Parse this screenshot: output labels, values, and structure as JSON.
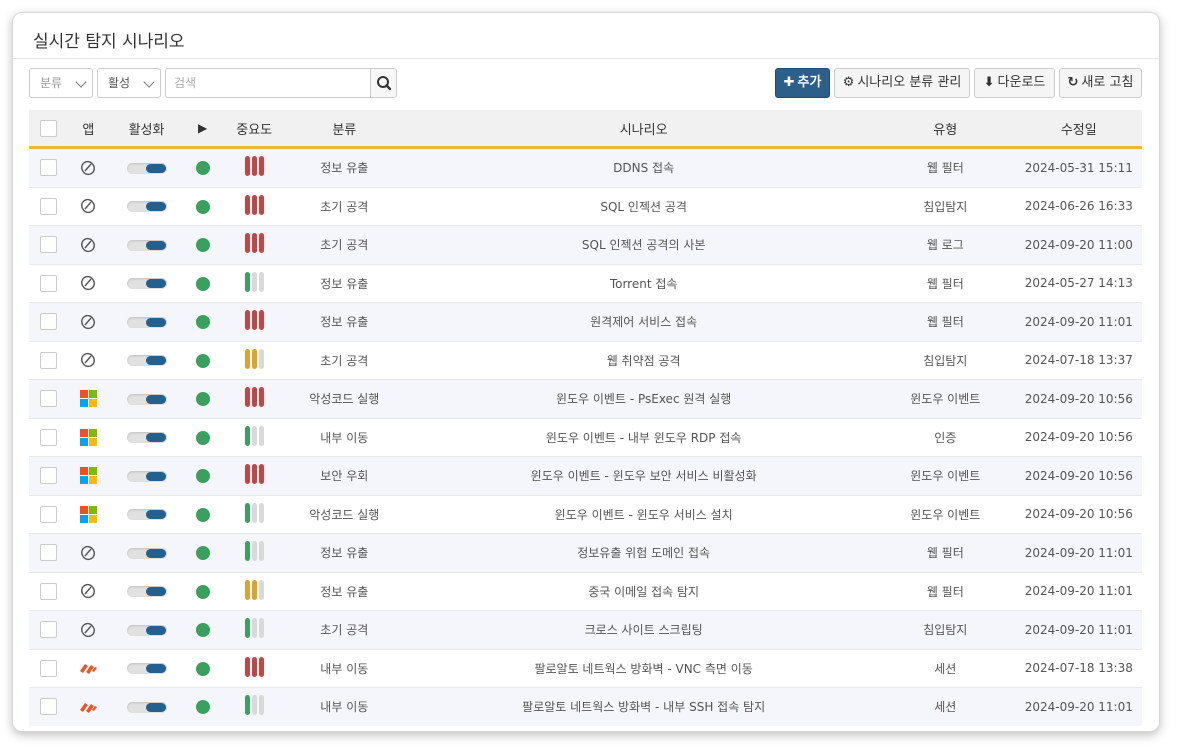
{
  "title": "실시간 탐지 시나리오",
  "toolbar": {
    "category_filter": "분류",
    "active_filter": "활성",
    "search_placeholder": "검색",
    "add_label": "추가",
    "category_manage_label": "시나리오 분류 관리",
    "download_label": "다운로드",
    "refresh_label": "새로 고침"
  },
  "colors": {
    "accent": "#2c5f8a",
    "header_underline": "#f0b92d",
    "severity_high": "#c54545",
    "severity_medium": "#e0a22a",
    "severity_low": "#3aa05d",
    "status_active": "#3aa05d"
  },
  "columns": [
    "앱",
    "활성화",
    "",
    "중요도",
    "분류",
    "시나리오",
    "유형",
    "수정일"
  ],
  "rows": [
    {
      "app": "link-icon",
      "active": true,
      "severity": "high",
      "category": "정보 유출",
      "scenario": "DDNS 접속",
      "type": "웹 필터",
      "modified": "2024-05-31 15:11"
    },
    {
      "app": "link-icon",
      "active": true,
      "severity": "high",
      "category": "초기 공격",
      "scenario": "SQL 인젝션 공격",
      "type": "침입탐지",
      "modified": "2024-06-26 16:33"
    },
    {
      "app": "link-icon",
      "active": true,
      "severity": "high",
      "category": "초기 공격",
      "scenario": "SQL 인젝션 공격의 사본",
      "type": "웹 로그",
      "modified": "2024-09-20 11:00"
    },
    {
      "app": "link-icon",
      "active": true,
      "severity": "low",
      "category": "정보 유출",
      "scenario": "Torrent 접속",
      "type": "웹 필터",
      "modified": "2024-05-27 14:13"
    },
    {
      "app": "link-icon",
      "active": true,
      "severity": "high",
      "category": "정보 유출",
      "scenario": "원격제어 서비스 접속",
      "type": "웹 필터",
      "modified": "2024-09-20 11:01"
    },
    {
      "app": "link-icon",
      "active": true,
      "severity": "medium",
      "category": "초기 공격",
      "scenario": "웹 취약점 공격",
      "type": "침입탐지",
      "modified": "2024-07-18 13:37"
    },
    {
      "app": "windows-icon",
      "active": true,
      "severity": "high",
      "category": "악성코드 실행",
      "scenario": "윈도우 이벤트 - PsExec 원격 실행",
      "type": "윈도우 이벤트",
      "modified": "2024-09-20 10:56"
    },
    {
      "app": "windows-icon",
      "active": true,
      "severity": "low",
      "category": "내부 이동",
      "scenario": "윈도우 이벤트 - 내부 윈도우 RDP 접속",
      "type": "인증",
      "modified": "2024-09-20 10:56"
    },
    {
      "app": "windows-icon",
      "active": true,
      "severity": "high",
      "category": "보안 우회",
      "scenario": "윈도우 이벤트 - 윈도우 보안 서비스 비활성화",
      "type": "윈도우 이벤트",
      "modified": "2024-09-20 10:56"
    },
    {
      "app": "windows-icon",
      "active": true,
      "severity": "low",
      "category": "악성코드 실행",
      "scenario": "윈도우 이벤트 - 윈도우 서비스 설치",
      "type": "윈도우 이벤트",
      "modified": "2024-09-20 10:56"
    },
    {
      "app": "link-icon",
      "active": true,
      "severity": "low",
      "category": "정보 유출",
      "scenario": "정보유출 위험 도메인 접속",
      "type": "웹 필터",
      "modified": "2024-09-20 11:01"
    },
    {
      "app": "link-icon",
      "active": true,
      "severity": "medium",
      "category": "정보 유출",
      "scenario": "중국 이메일 접속 탐지",
      "type": "웹 필터",
      "modified": "2024-09-20 11:01"
    },
    {
      "app": "link-icon",
      "active": true,
      "severity": "low",
      "category": "초기 공격",
      "scenario": "크로스 사이트 스크립팅",
      "type": "침입탐지",
      "modified": "2024-09-20 11:01"
    },
    {
      "app": "paloalto-icon",
      "active": true,
      "severity": "high",
      "category": "내부 이동",
      "scenario": "팔로알토 네트웍스 방화벽 - VNC 측면 이동",
      "type": "세션",
      "modified": "2024-07-18 13:38"
    },
    {
      "app": "paloalto-icon",
      "active": true,
      "severity": "low",
      "category": "내부 이동",
      "scenario": "팔로알토 네트웍스 방화벽 - 내부 SSH 접속 탐지",
      "type": "세션",
      "modified": "2024-09-20 11:01"
    }
  ]
}
